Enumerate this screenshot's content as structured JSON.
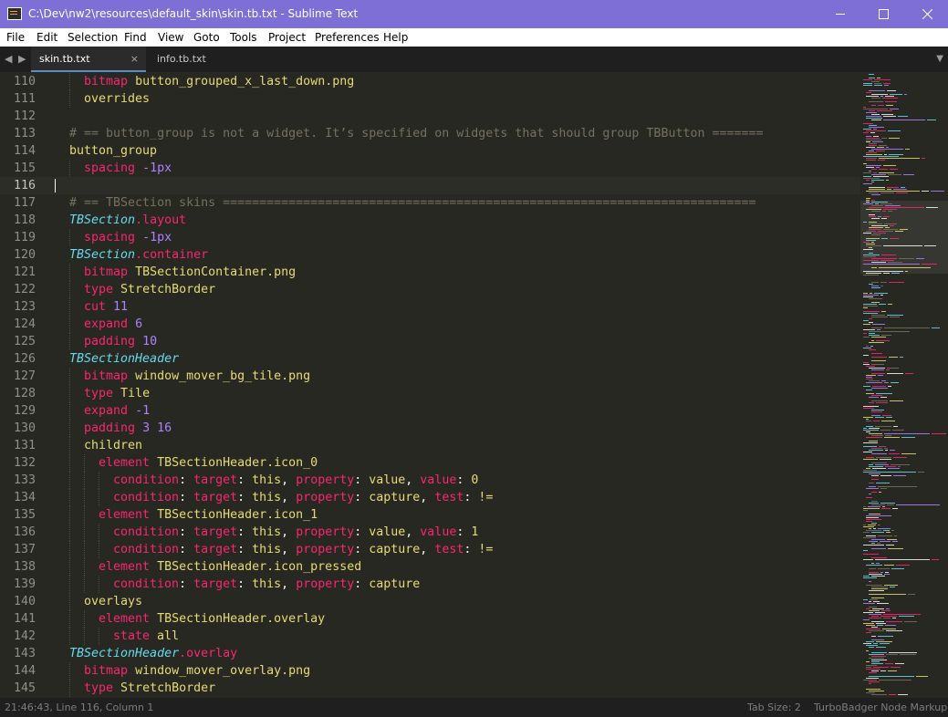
{
  "window": {
    "title": "C:\\Dev\\nw2\\resources\\default_skin\\skin.tb.txt - Sublime Text",
    "minimize_glyph": "—",
    "icon": "sublime-text-app-icon"
  },
  "menu": [
    "File",
    "Edit",
    "Selection",
    "Find",
    "View",
    "Goto",
    "Tools",
    "Project",
    "Preferences",
    "Help"
  ],
  "tabs": {
    "nav_left": "◀",
    "nav_right": "▶",
    "active": {
      "label": "skin.tb.txt",
      "close": "×"
    },
    "inactive": {
      "label": "info.tb.txt"
    },
    "dropdown": "▼"
  },
  "editor": {
    "current_line": 116,
    "lines": [
      {
        "num": "110",
        "indent": 2,
        "tokens": [
          [
            "k",
            "bitmap"
          ],
          [
            "w",
            " "
          ],
          [
            "v",
            "button_grouped_x_last_down.png"
          ]
        ]
      },
      {
        "num": "111",
        "indent": 2,
        "tokens": [
          [
            "v",
            "overrides"
          ]
        ]
      },
      {
        "num": "112",
        "indent": 0,
        "tokens": []
      },
      {
        "num": "113",
        "indent": 1,
        "tokens": [
          [
            "c",
            "# == button_group is not a widget. It’s specified on widgets that should group TBButton ======="
          ]
        ]
      },
      {
        "num": "114",
        "indent": 1,
        "tokens": [
          [
            "v",
            "button_group"
          ]
        ]
      },
      {
        "num": "115",
        "indent": 2,
        "tokens": [
          [
            "k",
            "spacing"
          ],
          [
            "w",
            " "
          ],
          [
            "n",
            "-1px"
          ]
        ]
      },
      {
        "num": "116",
        "indent": 0,
        "tokens": []
      },
      {
        "num": "117",
        "indent": 1,
        "tokens": [
          [
            "c",
            "# == TBSection skins ========================================================================="
          ]
        ]
      },
      {
        "num": "118",
        "indent": 1,
        "tokens": [
          [
            "cls",
            "TBSection"
          ],
          [
            "k",
            ".layout"
          ]
        ]
      },
      {
        "num": "119",
        "indent": 2,
        "tokens": [
          [
            "k",
            "spacing"
          ],
          [
            "w",
            " "
          ],
          [
            "n",
            "-1px"
          ]
        ]
      },
      {
        "num": "120",
        "indent": 1,
        "tokens": [
          [
            "cls",
            "TBSection"
          ],
          [
            "k",
            ".container"
          ]
        ]
      },
      {
        "num": "121",
        "indent": 2,
        "tokens": [
          [
            "k",
            "bitmap"
          ],
          [
            "w",
            " "
          ],
          [
            "v",
            "TBSectionContainer.png"
          ]
        ]
      },
      {
        "num": "122",
        "indent": 2,
        "tokens": [
          [
            "k",
            "type"
          ],
          [
            "w",
            " "
          ],
          [
            "v",
            "StretchBorder"
          ]
        ]
      },
      {
        "num": "123",
        "indent": 2,
        "tokens": [
          [
            "k",
            "cut"
          ],
          [
            "w",
            " "
          ],
          [
            "n",
            "11"
          ]
        ]
      },
      {
        "num": "124",
        "indent": 2,
        "tokens": [
          [
            "k",
            "expand"
          ],
          [
            "w",
            " "
          ],
          [
            "n",
            "6"
          ]
        ]
      },
      {
        "num": "125",
        "indent": 2,
        "tokens": [
          [
            "k",
            "padding"
          ],
          [
            "w",
            " "
          ],
          [
            "n",
            "10"
          ]
        ]
      },
      {
        "num": "126",
        "indent": 1,
        "tokens": [
          [
            "cls",
            "TBSectionHeader"
          ]
        ]
      },
      {
        "num": "127",
        "indent": 2,
        "tokens": [
          [
            "k",
            "bitmap"
          ],
          [
            "w",
            " "
          ],
          [
            "v",
            "window_mover_bg_tile.png"
          ]
        ]
      },
      {
        "num": "128",
        "indent": 2,
        "tokens": [
          [
            "k",
            "type"
          ],
          [
            "w",
            " "
          ],
          [
            "v",
            "Tile"
          ]
        ]
      },
      {
        "num": "129",
        "indent": 2,
        "tokens": [
          [
            "k",
            "expand"
          ],
          [
            "w",
            " "
          ],
          [
            "n",
            "-1"
          ]
        ]
      },
      {
        "num": "130",
        "indent": 2,
        "tokens": [
          [
            "k",
            "padding"
          ],
          [
            "w",
            " "
          ],
          [
            "n",
            "3 16"
          ]
        ]
      },
      {
        "num": "131",
        "indent": 2,
        "tokens": [
          [
            "v",
            "children"
          ]
        ]
      },
      {
        "num": "132",
        "indent": 3,
        "tokens": [
          [
            "k",
            "element"
          ],
          [
            "w",
            " "
          ],
          [
            "v",
            "TBSectionHeader.icon_0"
          ]
        ]
      },
      {
        "num": "133",
        "indent": 4,
        "tokens": [
          [
            "k",
            "condition"
          ],
          [
            "w",
            ": "
          ],
          [
            "k",
            "target"
          ],
          [
            "w",
            ": "
          ],
          [
            "v",
            "this"
          ],
          [
            "w",
            ", "
          ],
          [
            "k",
            "property"
          ],
          [
            "w",
            ": "
          ],
          [
            "v",
            "value"
          ],
          [
            "w",
            ", "
          ],
          [
            "k",
            "value"
          ],
          [
            "w",
            ": "
          ],
          [
            "v",
            "0"
          ]
        ]
      },
      {
        "num": "134",
        "indent": 4,
        "tokens": [
          [
            "k",
            "condition"
          ],
          [
            "w",
            ": "
          ],
          [
            "k",
            "target"
          ],
          [
            "w",
            ": "
          ],
          [
            "v",
            "this"
          ],
          [
            "w",
            ", "
          ],
          [
            "k",
            "property"
          ],
          [
            "w",
            ": "
          ],
          [
            "v",
            "capture"
          ],
          [
            "w",
            ", "
          ],
          [
            "k",
            "test"
          ],
          [
            "w",
            ": "
          ],
          [
            "v",
            "!="
          ]
        ]
      },
      {
        "num": "135",
        "indent": 3,
        "tokens": [
          [
            "k",
            "element"
          ],
          [
            "w",
            " "
          ],
          [
            "v",
            "TBSectionHeader.icon_1"
          ]
        ]
      },
      {
        "num": "136",
        "indent": 4,
        "tokens": [
          [
            "k",
            "condition"
          ],
          [
            "w",
            ": "
          ],
          [
            "k",
            "target"
          ],
          [
            "w",
            ": "
          ],
          [
            "v",
            "this"
          ],
          [
            "w",
            ", "
          ],
          [
            "k",
            "property"
          ],
          [
            "w",
            ": "
          ],
          [
            "v",
            "value"
          ],
          [
            "w",
            ", "
          ],
          [
            "k",
            "value"
          ],
          [
            "w",
            ": "
          ],
          [
            "v",
            "1"
          ]
        ]
      },
      {
        "num": "137",
        "indent": 4,
        "tokens": [
          [
            "k",
            "condition"
          ],
          [
            "w",
            ": "
          ],
          [
            "k",
            "target"
          ],
          [
            "w",
            ": "
          ],
          [
            "v",
            "this"
          ],
          [
            "w",
            ", "
          ],
          [
            "k",
            "property"
          ],
          [
            "w",
            ": "
          ],
          [
            "v",
            "capture"
          ],
          [
            "w",
            ", "
          ],
          [
            "k",
            "test"
          ],
          [
            "w",
            ": "
          ],
          [
            "v",
            "!="
          ]
        ]
      },
      {
        "num": "138",
        "indent": 3,
        "tokens": [
          [
            "k",
            "element"
          ],
          [
            "w",
            " "
          ],
          [
            "v",
            "TBSectionHeader.icon_pressed"
          ]
        ]
      },
      {
        "num": "139",
        "indent": 4,
        "tokens": [
          [
            "k",
            "condition"
          ],
          [
            "w",
            ": "
          ],
          [
            "k",
            "target"
          ],
          [
            "w",
            ": "
          ],
          [
            "v",
            "this"
          ],
          [
            "w",
            ", "
          ],
          [
            "k",
            "property"
          ],
          [
            "w",
            ": "
          ],
          [
            "v",
            "capture"
          ]
        ]
      },
      {
        "num": "140",
        "indent": 2,
        "tokens": [
          [
            "v",
            "overlays"
          ]
        ]
      },
      {
        "num": "141",
        "indent": 3,
        "tokens": [
          [
            "k",
            "element"
          ],
          [
            "w",
            " "
          ],
          [
            "v",
            "TBSectionHeader.overlay"
          ]
        ]
      },
      {
        "num": "142",
        "indent": 4,
        "tokens": [
          [
            "k",
            "state"
          ],
          [
            "w",
            " "
          ],
          [
            "v",
            "all"
          ]
        ]
      },
      {
        "num": "143",
        "indent": 1,
        "tokens": [
          [
            "cls",
            "TBSectionHeader"
          ],
          [
            "k",
            ".overlay"
          ]
        ]
      },
      {
        "num": "144",
        "indent": 2,
        "tokens": [
          [
            "k",
            "bitmap"
          ],
          [
            "w",
            " "
          ],
          [
            "v",
            "window_mover_overlay.png"
          ]
        ]
      },
      {
        "num": "145",
        "indent": 2,
        "tokens": [
          [
            "k",
            "type"
          ],
          [
            "w",
            " "
          ],
          [
            "v",
            "StretchBorder"
          ]
        ]
      }
    ]
  },
  "status": {
    "position": "21:46:43, Line 116, Column 1",
    "tab_size": "Tab Size: 2",
    "syntax": "TurboBadger Node Markup"
  },
  "colors": {
    "titlebar": "#7e6fd6",
    "background": "#272822",
    "keyword": "#f92672",
    "string": "#e6db74",
    "number": "#ae81ff",
    "comment": "#75715e",
    "class": "#66d9ef"
  }
}
